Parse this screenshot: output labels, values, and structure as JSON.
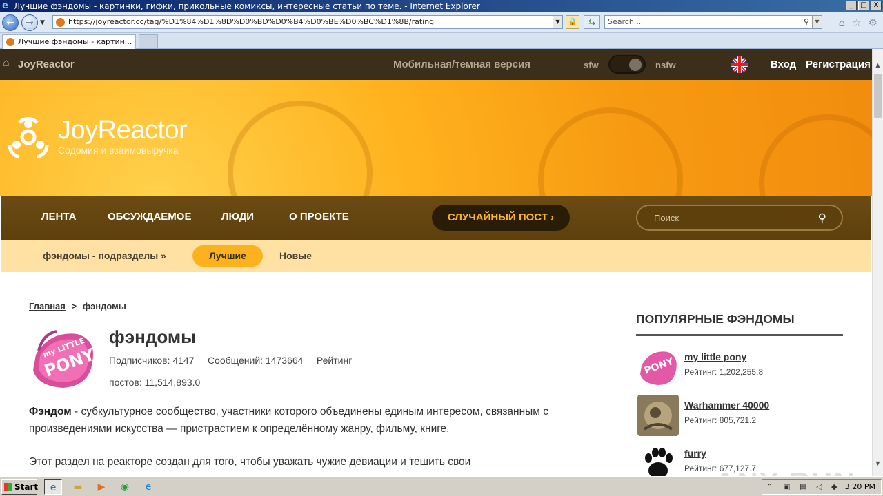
{
  "window": {
    "title": "Лучшие фэндомы - картинки, гифки, прикольные комиксы, интересные статьи по теме. - Internet Explorer",
    "minimize": "_",
    "maximize": "□",
    "close": "X"
  },
  "browser": {
    "url": "https://joyreactor.cc/tag/%D1%84%D1%8D%D0%BD%D0%B4%D0%BE%D0%BC%D1%8B/rating",
    "search_placeholder": "Search...",
    "tab_title": "Лучшие фэндомы - картин..."
  },
  "topbar": {
    "brand": "JoyReactor",
    "mobile": "Мобильная/темная версия",
    "sfw": "sfw",
    "nsfw": "nsfw",
    "login": "Вход",
    "register": "Регистрация"
  },
  "hero": {
    "logo_text": "JoyReactor",
    "logo_sub": "Содомия и взаимовыручка"
  },
  "mainnav": {
    "items": [
      "ЛЕНТА",
      "ОБСУЖДАЕМОЕ",
      "ЛЮДИ",
      "О ПРОЕКТЕ"
    ],
    "random": "СЛУЧАЙНЫЙ ПОСТ  ›",
    "search_placeholder": "Поиск"
  },
  "subnav": {
    "subsections": "фэндомы - подразделы »",
    "best": "Лучшие",
    "new": "Новые"
  },
  "breadcrumb": {
    "home": "Главная",
    "sep": ">",
    "current": "фэндомы"
  },
  "tag": {
    "name": "фэндомы",
    "stats_line": "Подписчиков: 4147     Сообщений: 1473664     Рейтинг",
    "stats_line2": "постов: 11,514,893.0",
    "desc_bold": "Фэндом",
    "desc_rest": " - субкультурное сообщество, участники которого объединены единым интересом, связанным с произведениями искусства — пристрастием к определённому жанру, фильму, книге.",
    "desc2": "Этот раздел на реакторе создан для того, чтобы уважать чужие девиации и тешить свои"
  },
  "sidebar": {
    "title": "ПОПУЛЯРНЫЕ ФЭНДОМЫ",
    "items": [
      {
        "name": "my little pony",
        "rating": "Рейтинг: 1,202,255.8"
      },
      {
        "name": "Warhammer 40000",
        "rating": "Рейтинг: 805,721.2"
      },
      {
        "name": "furry",
        "rating": "Рейтинг: 677,127.7"
      }
    ]
  },
  "watermark": "ANY RUN",
  "taskbar": {
    "start": "Start",
    "clock": "3:20 PM"
  }
}
